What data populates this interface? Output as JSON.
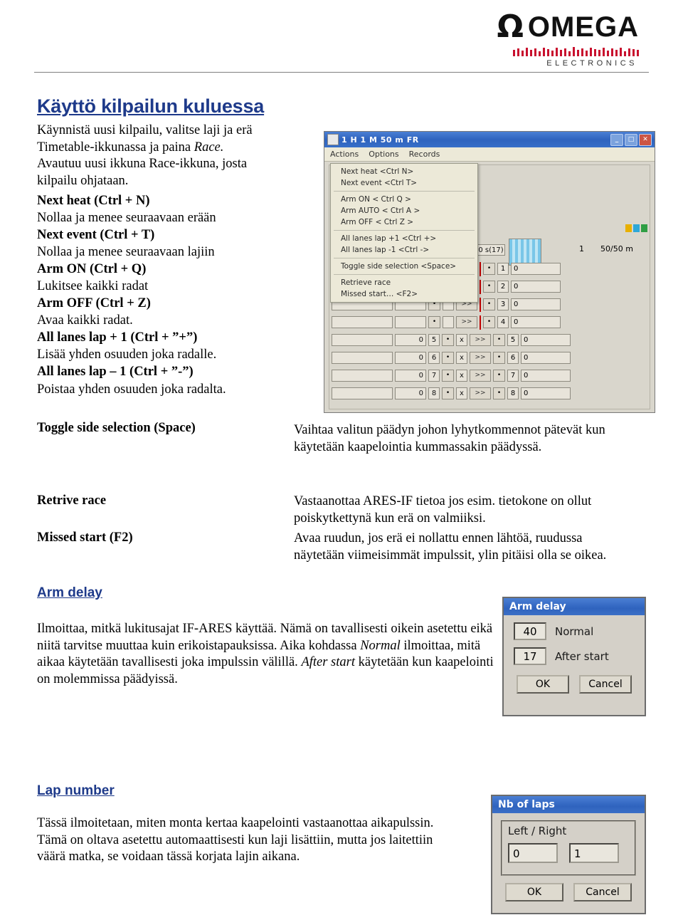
{
  "header": {
    "logo_symbol": "Ω",
    "logo_word": "OMEGA",
    "logo_sub": "ELECTRONICS"
  },
  "doc": {
    "section_title": "Käyttö kilpailun kuluessa",
    "intro_line1": "Käynnistä uusi kilpailu, valitse laji ja erä",
    "intro_line2_a": "Timetable-ikkunassa ja paina ",
    "intro_line2_i": "Race.",
    "intro_line3": "Avautuu uusi ikkuna Race-ikkuna, josta",
    "intro_line4": "kilpailu ohjataan.",
    "keys": [
      {
        "key": "Next heat (Ctrl + N)",
        "desc": "Nollaa ja menee seuraavaan erään"
      },
      {
        "key": "Next event (Ctrl + T)",
        "desc": "Nollaa ja menee seuraavaan lajiin"
      },
      {
        "key": "Arm ON (Ctrl + Q)",
        "desc": "Lukitsee kaikki radat"
      },
      {
        "key": "Arm OFF (Ctrl + Z)",
        "desc": "Avaa kaikki radat."
      },
      {
        "key": "All lanes lap + 1 (Ctrl + ”+”)",
        "desc": "Lisää yhden osuuden joka radalle."
      },
      {
        "key": "All lanes lap – 1 (Ctrl + ”-”)",
        "desc": "Poistaa yhden osuuden joka radalta."
      }
    ],
    "toggle_label": "Toggle side selection (Space)",
    "toggle_desc": "Vaihtaa valitun päädyn johon lyhytkommennot pätevät kun käytetään kaapelointia kummassakin päädyssä.",
    "retrieve_label": "Retrive race",
    "retrieve_desc": "Vastaanottaa ARES-IF tietoa jos esim. tietokone on ollut poiskytkettynä kun erä on valmiiksi.",
    "missed_label": "Missed start (F2)",
    "missed_desc": "Avaa ruudun, jos erä ei nollattu ennen lähtöä, ruudussa näytetään viimeisimmät impulssit, ylin pitäisi olla se oikea.",
    "armdelay_label": "Arm delay",
    "armdelay_text_1": "Ilmoittaa, mitkä lukitusajat IF-ARES käyttää. Nämä on tavallisesti oikein asetettu eikä niitä tarvitse muuttaa kuin erikoistapauksissa. Aika kohdassa ",
    "armdelay_text_i1": "Normal",
    "armdelay_text_2": " ilmoittaa, mitä aikaa käytetään tavallisesti joka impulssin välillä. ",
    "armdelay_text_i2": "After start",
    "armdelay_text_3": " käytetään kun kaapelointi on molemmissa päädyissä.",
    "lapnumber_label": "Lap number",
    "lapnumber_text": "Tässä ilmoitetaan, miten monta kertaa kaapelointi vastaanottaa aikapulssin. Tämä on oltava asetettu automaattisesti kun laji lisättiin, mutta jos laitettiin väärä matka, se voidaan tässä korjata lajin aikana."
  },
  "race_window": {
    "title": "1 H 1  M 50 m FR",
    "minimize": "_",
    "maximize": "□",
    "close": "✕",
    "menus": [
      "Actions",
      "Options",
      "Records"
    ],
    "menu_items": [
      "Next heat  <Ctrl N>",
      "Next event  <Ctrl T>",
      "Arm ON  < Ctrl Q >",
      "Arm AUTO  < Ctrl A >",
      "Arm OFF  < Ctrl Z >",
      "All lanes lap +1  <Ctrl +>",
      "All lanes lap -1  <Ctrl ->",
      "Toggle side selection  <Space>",
      "Retrieve race",
      "Missed start…   <F2>"
    ],
    "time_box": "40 s(17)",
    "lane_count": "1",
    "distance": "50/50 m",
    "rows": [
      {
        "value": "",
        "num": "",
        "lane": "1",
        "lane_value": "0"
      },
      {
        "value": "",
        "num": "",
        "lane": "2",
        "lane_value": "0"
      },
      {
        "value": "",
        "num": "",
        "lane": "3",
        "lane_value": "0"
      },
      {
        "value": "",
        "num": "",
        "lane": "4",
        "lane_value": "0"
      },
      {
        "value": "0",
        "num": "5",
        "lane": "5",
        "lane_value": "0"
      },
      {
        "value": "0",
        "num": "6",
        "lane": "6",
        "lane_value": "0"
      },
      {
        "value": "0",
        "num": "7",
        "lane": "7",
        "lane_value": "0"
      },
      {
        "value": "0",
        "num": "8",
        "lane": "8",
        "lane_value": "0"
      }
    ],
    "x_label": "x",
    "arrow_label": ">>",
    "dot_label": "•"
  },
  "arm_delay_dialog": {
    "title": "Arm delay",
    "normal_value": "40",
    "normal_label": "Normal",
    "after_start_value": "17",
    "after_start_label": "After start",
    "ok": "OK",
    "cancel": "Cancel"
  },
  "laps_dialog": {
    "title": "Nb of laps",
    "group_label": "Left / Right",
    "left_value": "0",
    "right_value": "1",
    "ok": "OK",
    "cancel": "Cancel"
  }
}
